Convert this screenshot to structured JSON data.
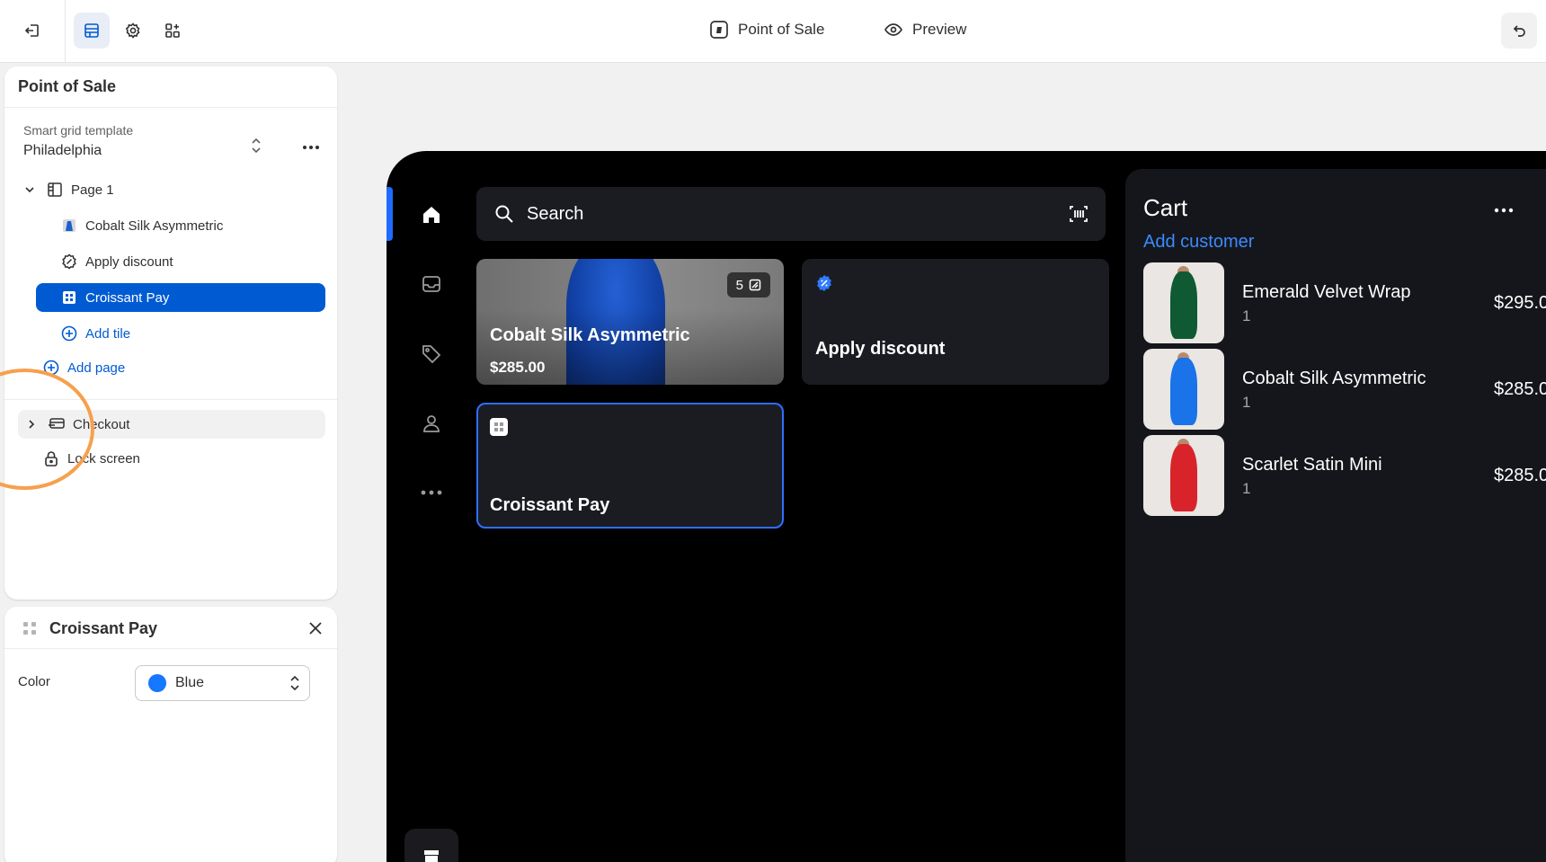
{
  "topbar": {
    "title": "Point of Sale",
    "preview_label": "Preview"
  },
  "editor": {
    "panel_title": "Point of Sale",
    "template_label": "Smart grid template",
    "template_value": "Philadelphia",
    "page_label": "Page 1",
    "tiles": [
      {
        "label": "Cobalt Silk Asymmetric"
      },
      {
        "label": "Apply discount"
      },
      {
        "label": "Croissant Pay"
      }
    ],
    "add_tile": "Add tile",
    "add_page": "Add page",
    "checkout": "Checkout",
    "lock_screen": "Lock screen"
  },
  "settings": {
    "title": "Croissant Pay",
    "color_label": "Color",
    "color_value": "Blue",
    "color_hex": "#1677ff"
  },
  "pos": {
    "search_placeholder": "Search",
    "product_tile": {
      "name": "Cobalt Silk Asymmetric",
      "price": "$285.00",
      "variants": "5"
    },
    "discount_tile": {
      "label": "Apply discount"
    },
    "pay_tile": {
      "label": "Croissant Pay"
    },
    "cart": {
      "title": "Cart",
      "add_customer": "Add customer",
      "items": [
        {
          "name": "Emerald Velvet Wrap",
          "qty": "1",
          "price": "$295.0",
          "color": "#0f5a33"
        },
        {
          "name": "Cobalt Silk Asymmetric",
          "qty": "1",
          "price": "$285.0",
          "color": "#1a73e8"
        },
        {
          "name": "Scarlet Satin Mini",
          "qty": "1",
          "price": "$285.0",
          "color": "#d8232a"
        }
      ]
    }
  }
}
